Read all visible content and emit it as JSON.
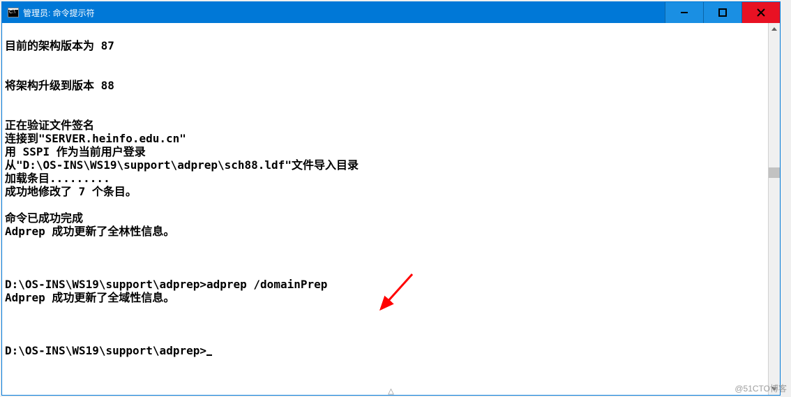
{
  "window": {
    "title": "管理员: 命令提示符"
  },
  "terminal": {
    "lines": [
      "",
      "目前的架构版本为 87",
      "",
      "",
      "将架构升级到版本 88",
      "",
      "",
      "正在验证文件签名",
      "连接到\"SERVER.heinfo.edu.cn\"",
      "用 SSPI 作为当前用户登录",
      "从\"D:\\OS-INS\\WS19\\support\\adprep\\sch88.ldf\"文件导入目录",
      "加载条目.........",
      "成功地修改了 7 个条目。",
      "",
      "命令已成功完成",
      "Adprep 成功更新了全林性信息。",
      "",
      "",
      "",
      "D:\\OS-INS\\WS19\\support\\adprep>adprep /domainPrep",
      "Adprep 成功更新了全域性信息。",
      "",
      "",
      "",
      "D:\\OS-INS\\WS19\\support\\adprep>"
    ]
  },
  "icons": {
    "minimize": "minimize-icon",
    "maximize": "maximize-icon",
    "close": "close-icon",
    "scroll_up": "chevron-up-icon",
    "scroll_down": "chevron-down-icon"
  },
  "watermark": "@51CTO博客"
}
